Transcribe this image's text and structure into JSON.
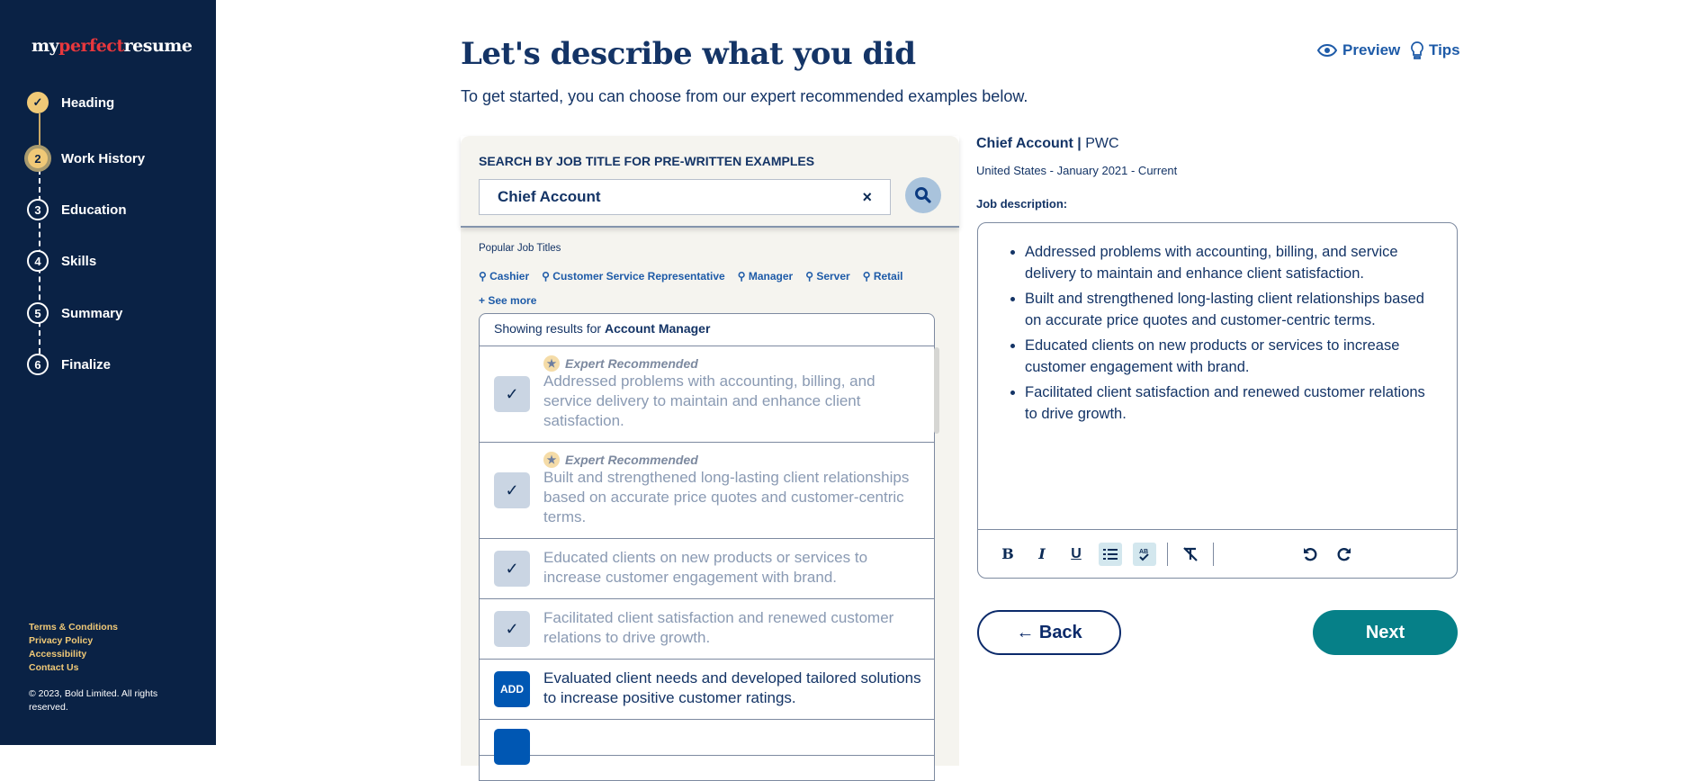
{
  "sidebar": {
    "logo": {
      "part1": "my",
      "part2": "perfect",
      "part3": "resume"
    },
    "steps": [
      {
        "num": "✓",
        "label": "Heading",
        "state": "done"
      },
      {
        "num": "2",
        "label": "Work History",
        "state": "current"
      },
      {
        "num": "3",
        "label": "Education",
        "state": "todo"
      },
      {
        "num": "4",
        "label": "Skills",
        "state": "todo"
      },
      {
        "num": "5",
        "label": "Summary",
        "state": "todo"
      },
      {
        "num": "6",
        "label": "Finalize",
        "state": "todo"
      }
    ],
    "footer_links": [
      "Terms & Conditions",
      "Privacy Policy",
      "Accessibility",
      "Contact Us"
    ],
    "copyright": "© 2023, Bold Limited. All rights reserved."
  },
  "header": {
    "title": "Let's describe what you did",
    "subtitle": "To get started, you can choose from our expert recommended examples below.",
    "preview": "Preview",
    "tips": "Tips"
  },
  "search": {
    "label": "SEARCH BY JOB TITLE FOR PRE-WRITTEN EXAMPLES",
    "value": "Chief Account",
    "clear": "×",
    "popular_label": "Popular Job Titles",
    "popular": [
      "Cashier",
      "Customer Service Representative",
      "Manager",
      "Server",
      "Retail"
    ],
    "see_more": "+ See more"
  },
  "results": {
    "prefix": "Showing results for ",
    "query": "Account Manager",
    "expert_label": "Expert Recommended",
    "add_label": "ADD",
    "items": [
      {
        "text": "Addressed problems with accounting, billing, and service delivery to maintain and enhance client satisfaction.",
        "expert": true,
        "added": true
      },
      {
        "text": "Built and strengthened long-lasting client relationships based on accurate price quotes and customer-centric terms.",
        "expert": true,
        "added": true
      },
      {
        "text": "Educated clients on new products or services to increase customer engagement with brand.",
        "expert": false,
        "added": true
      },
      {
        "text": "Facilitated client satisfaction and renewed customer relations to drive growth.",
        "expert": false,
        "added": true
      },
      {
        "text": "Evaluated client needs and developed tailored solutions to increase positive customer ratings.",
        "expert": false,
        "added": false
      }
    ]
  },
  "job": {
    "title": "Chief Account",
    "company": "PWC",
    "details": "United States - January 2021 - Current",
    "desc_label": "Job description:",
    "bullets": [
      "Addressed problems with accounting, billing, and service delivery to maintain and enhance client satisfaction.",
      "Built and strengthened long-lasting client relationships based on accurate price quotes and customer-centric terms.",
      "Educated clients on new products or services to increase customer engagement with brand.",
      "Facilitated client satisfaction and renewed customer relations to drive growth."
    ]
  },
  "toolbar": {
    "bold": "B",
    "italic": "I",
    "underline": "U"
  },
  "nav": {
    "back": "← Back",
    "next": "Next"
  },
  "colors": {
    "sidebar": "#0a2245",
    "accent": "#f0c977",
    "teal": "#068088",
    "link": "#1e5ba8",
    "add": "#0057b3"
  }
}
